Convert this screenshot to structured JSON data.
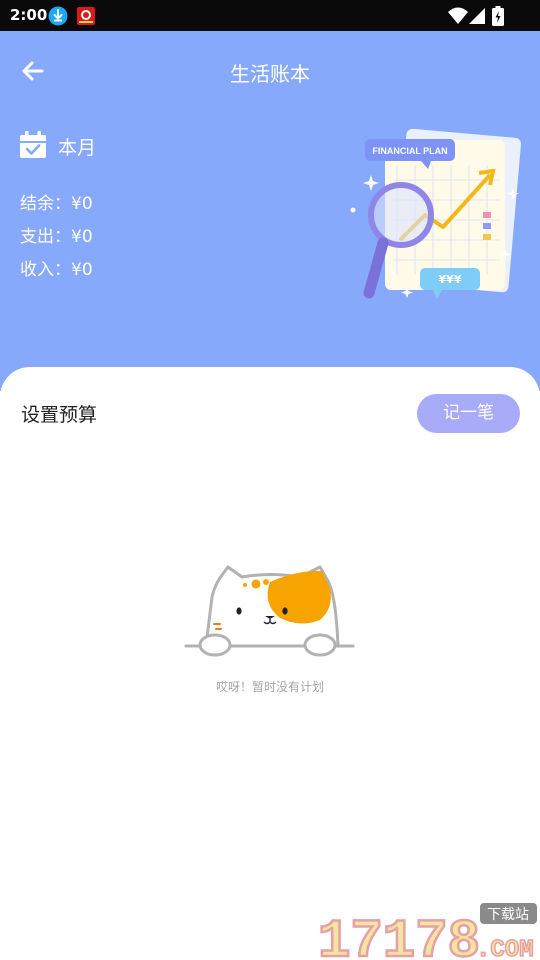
{
  "status_bar": {
    "time": "2:00",
    "icons": [
      "download-icon",
      "app-notification-icon",
      "wifi-icon",
      "signal-icon",
      "battery-icon"
    ]
  },
  "header": {
    "title": "生活账本",
    "back_icon": "arrow-left-icon",
    "month_label": "本月",
    "stats": {
      "balance": "结余：¥0",
      "expense": "支出：¥0",
      "income": "收入：¥0"
    },
    "illustration_label": "FINANCIAL PLAN",
    "illustration_currency": "¥¥¥"
  },
  "budget": {
    "title": "设置预算",
    "record_button": "记一笔",
    "empty_text": "哎呀！暂时没有计划"
  },
  "watermark": {
    "text": "17178",
    "suffix": ".COM",
    "badge": "下载站"
  },
  "colors": {
    "header_bg": "#86a9fb",
    "button_bg": "#a8acf8",
    "cat_orange": "#f7a400"
  }
}
